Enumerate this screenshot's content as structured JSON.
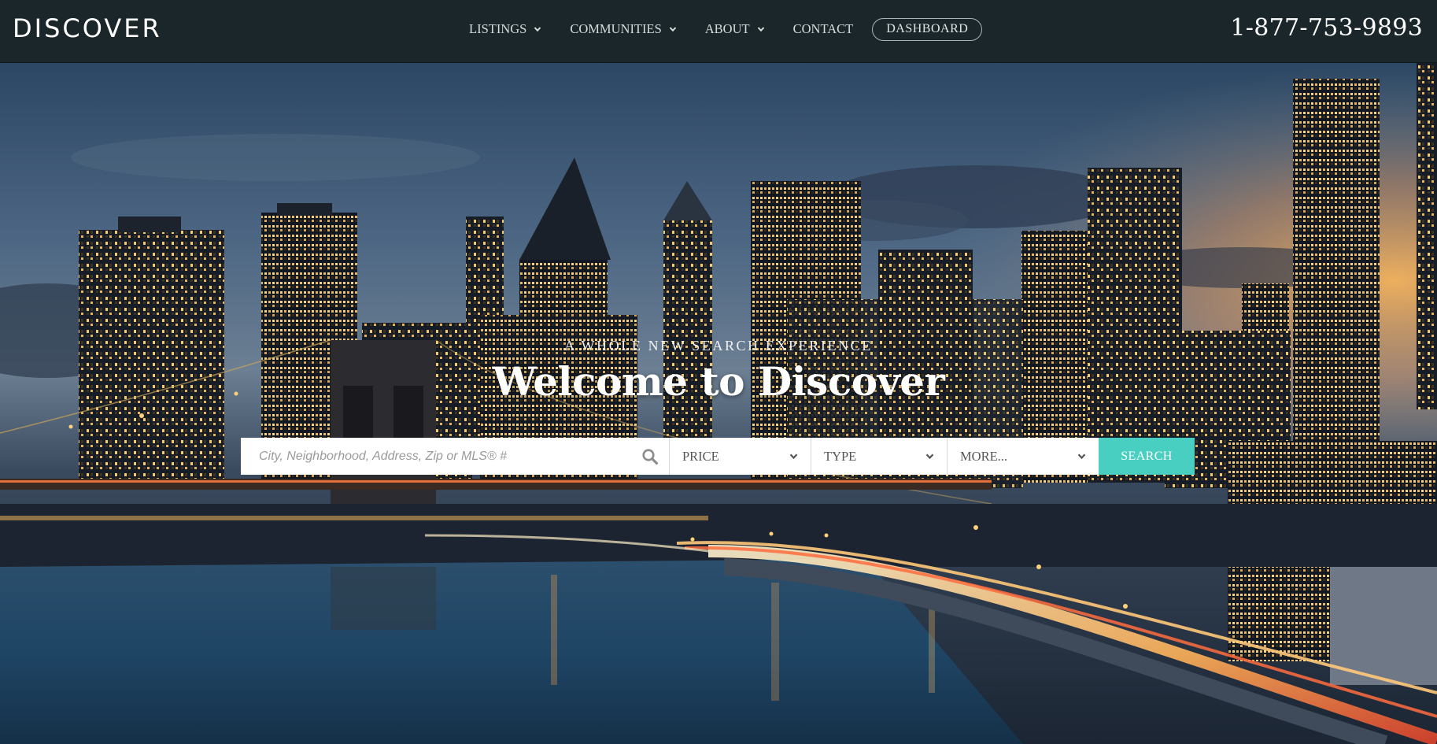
{
  "header": {
    "logo": "DISCOVER",
    "nav": [
      {
        "label": "LISTINGS",
        "has_dropdown": true
      },
      {
        "label": "COMMUNITIES",
        "has_dropdown": true
      },
      {
        "label": "ABOUT",
        "has_dropdown": true
      },
      {
        "label": "CONTACT",
        "has_dropdown": false
      }
    ],
    "dashboard_label": "DASHBOARD",
    "phone": "1-877-753-9893"
  },
  "hero": {
    "overline": "A WHOLE NEW SEARCH EXPERIENCE",
    "headline": "Welcome to Discover",
    "background_icon": "city-skyline-night-photo"
  },
  "search": {
    "placeholder": "City, Neighborhood, Address, Zip or MLS® #",
    "value": "",
    "search_icon": "magnifier-icon",
    "price_label": "PRICE",
    "type_label": "TYPE",
    "more_label": "MORE...",
    "button_label": "SEARCH"
  },
  "colors": {
    "header_bg": "#1a2629",
    "accent": "#49cfc1",
    "text_light": "#ffffff"
  }
}
